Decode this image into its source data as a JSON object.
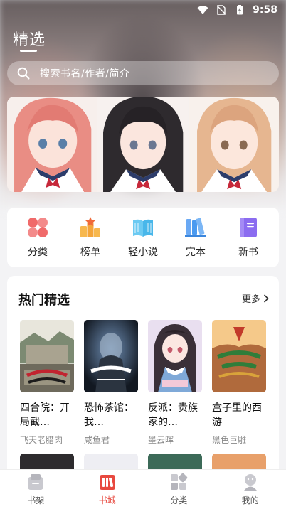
{
  "status_bar": {
    "time": "9:58"
  },
  "header": {
    "title": "精选"
  },
  "search": {
    "placeholder": "搜索书名/作者/简介"
  },
  "categories": [
    {
      "label": "分类",
      "icon": "grid-icon",
      "color": "#f06a6a"
    },
    {
      "label": "榜单",
      "icon": "ranking-icon",
      "color": "#f4a53a"
    },
    {
      "label": "轻小说",
      "icon": "open-book-icon",
      "color": "#49b7ea"
    },
    {
      "label": "完本",
      "icon": "books-icon",
      "color": "#4a9af0"
    },
    {
      "label": "新书",
      "icon": "new-book-icon",
      "color": "#8b6cf0"
    }
  ],
  "hot": {
    "title": "热门精选",
    "more": "更多",
    "books": [
      {
        "title": "四合院：开局截…",
        "author": "飞天老腊肉"
      },
      {
        "title": "恐怖茶馆：我…",
        "author": "咸鱼君"
      },
      {
        "title": "反派：贵族家的…",
        "author": "墨云晖"
      },
      {
        "title": "盒子里的西游",
        "author": "黑色巨雕"
      }
    ]
  },
  "tabs": [
    {
      "label": "书架",
      "icon": "bookshelf-icon"
    },
    {
      "label": "书城",
      "icon": "bookstore-icon",
      "active": true
    },
    {
      "label": "分类",
      "icon": "category-icon"
    },
    {
      "label": "我的",
      "icon": "profile-icon"
    }
  ],
  "colors": {
    "accent": "#e8493f",
    "background": "#f3f3f5"
  }
}
